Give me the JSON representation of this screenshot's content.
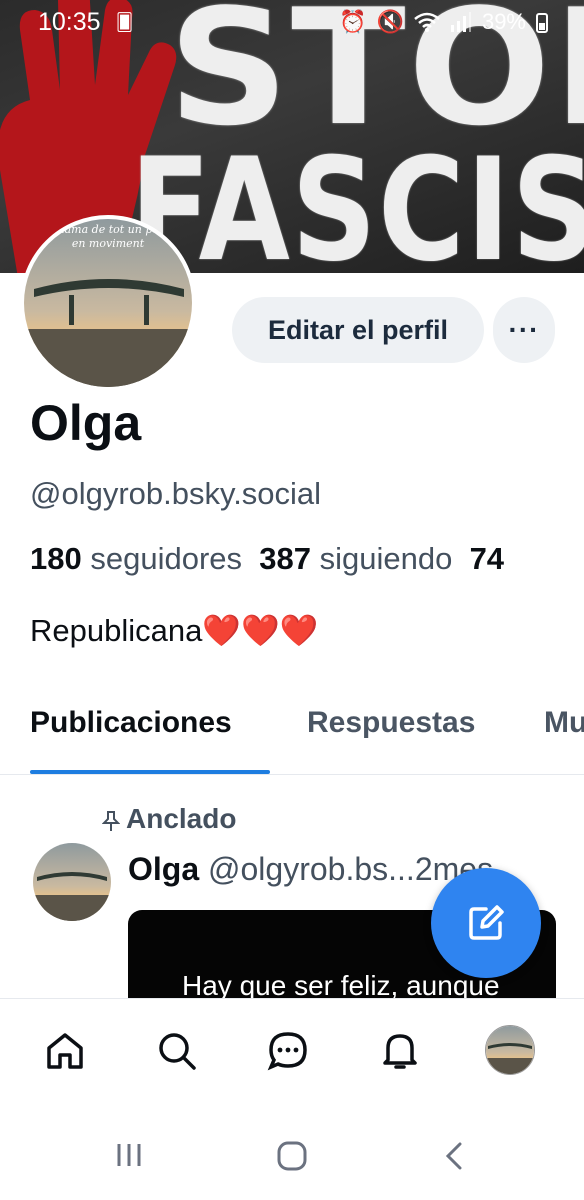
{
  "status_bar": {
    "time": "10:35",
    "battery": "39%"
  },
  "banner": {
    "line1": "STOP",
    "line2": "FASCISM"
  },
  "avatar": {
    "caption_line1": "La flama de tot un poble",
    "caption_line2": "en moviment"
  },
  "actions": {
    "edit_label": "Editar el perfil",
    "more_label": "···"
  },
  "profile": {
    "name": "Olga",
    "handle": "@olgyrob.bsky.social",
    "followers_count": "180",
    "followers_label": "seguidores",
    "following_count": "387",
    "following_label": "siguiendo",
    "posts_count_partial": "74",
    "bio": "Republicana❤️❤️❤️"
  },
  "tabs": [
    {
      "label": "Publicaciones",
      "active": true
    },
    {
      "label": "Respuestas",
      "active": false
    },
    {
      "label": "Mu",
      "active": false
    }
  ],
  "post": {
    "pinned_label": "Anclado",
    "author": "Olga",
    "handle_truncated": "@olgyrob.bs...",
    "age": "2mes",
    "image_text": "Hay que ser feliz, aunque"
  },
  "colors": {
    "accent": "#2f84f0",
    "tab_indicator": "#1e7de0",
    "muted_text": "#44505e"
  },
  "icons": {
    "bottom_nav": [
      "home-icon",
      "search-icon",
      "chat-icon",
      "bell-icon",
      "avatar"
    ],
    "system_nav": [
      "recents-icon",
      "home-button-icon",
      "back-icon"
    ]
  }
}
